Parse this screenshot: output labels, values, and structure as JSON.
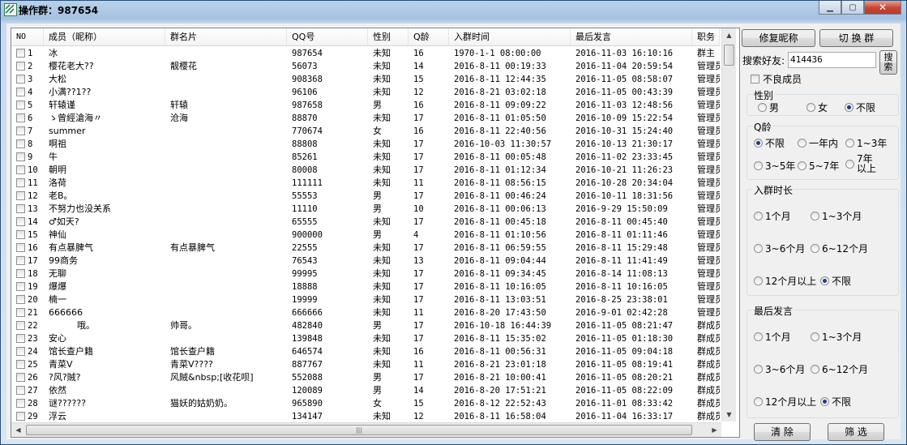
{
  "window": {
    "title": "操作群：987654"
  },
  "list": {
    "headers": [
      "NO",
      "成员（昵称）",
      "群名片",
      "QQ号",
      "性别",
      "Q龄",
      "入群时间",
      "最后发言",
      "职务"
    ],
    "rows": [
      [
        "1",
        "冰",
        "",
        "987654",
        "未知",
        "16",
        "1970-1-1 08:00:00",
        "2016-11-03 16:10:16",
        "群主"
      ],
      [
        "2",
        "樱花老大??",
        "靓樱花",
        "56073",
        "未知",
        "14",
        "2016-8-11 00:19:33",
        "2016-11-04 20:59:54",
        "管理员"
      ],
      [
        "3",
        "大松",
        "",
        "908368",
        "未知",
        "15",
        "2016-8-11 12:44:35",
        "2016-11-05 08:58:07",
        "管理员"
      ],
      [
        "4",
        "小满??1??",
        "",
        "96106",
        "未知",
        "12",
        "2016-8-21 03:02:18",
        "2016-11-05 00:43:39",
        "管理员"
      ],
      [
        "5",
        "轩辕谨",
        "轩辕",
        "987658",
        "男",
        "16",
        "2016-8-11 09:09:22",
        "2016-11-03 12:48:56",
        "管理员"
      ],
      [
        "6",
        "ゝ曾經滄海〃",
        "沧海",
        "88870",
        "未知",
        "17",
        "2016-8-11 01:05:50",
        "2016-10-09 15:22:54",
        "管理员"
      ],
      [
        "7",
        "summer",
        "",
        "770674",
        "女",
        "16",
        "2016-8-11 22:40:56",
        "2016-10-31 15:24:40",
        "管理员"
      ],
      [
        "8",
        "啊祖",
        "",
        "88808",
        "未知",
        "17",
        "2016-10-03 11:30:57",
        "2016-10-13 21:30:17",
        "管理员"
      ],
      [
        "9",
        "牛",
        "",
        "85261",
        "未知",
        "17",
        "2016-8-11 00:05:48",
        "2016-11-02 23:33:45",
        "管理员"
      ],
      [
        "10",
        "朝明",
        "",
        "80008",
        "未知",
        "17",
        "2016-8-11 01:12:34",
        "2016-10-21 11:26:23",
        "管理员"
      ],
      [
        "11",
        "洛荷",
        "",
        "111111",
        "未知",
        "11",
        "2016-8-11 08:56:15",
        "2016-10-28 20:34:04",
        "管理员"
      ],
      [
        "12",
        "老B。",
        "",
        "55553",
        "男",
        "17",
        "2016-8-11 00:46:24",
        "2016-10-11 18:31:56",
        "管理员"
      ],
      [
        "13",
        "不努力也没关系",
        "",
        "11110",
        "男",
        "10",
        "2016-8-11 00:06:13",
        "2016-9-29 15:50:09",
        "管理员"
      ],
      [
        "14",
        "♂如天?",
        "",
        "65555",
        "未知",
        "17",
        "2016-8-11 00:45:18",
        "2016-8-11 00:45:40",
        "管理员"
      ],
      [
        "15",
        "神仙",
        "",
        "900000",
        "男",
        "4",
        "2016-8-11 01:10:56",
        "2016-8-11 01:11:46",
        "管理员"
      ],
      [
        "16",
        "有点暴脾气",
        "有点暴脾气",
        "22555",
        "未知",
        "17",
        "2016-8-11 06:59:55",
        "2016-8-11 15:29:48",
        "管理员"
      ],
      [
        "17",
        "99商务",
        "",
        "76543",
        "未知",
        "13",
        "2016-8-11 09:04:44",
        "2016-8-11 11:41:49",
        "管理员"
      ],
      [
        "18",
        "无聊",
        "",
        "99995",
        "未知",
        "17",
        "2016-8-11 09:34:45",
        "2016-8-14 11:08:13",
        "管理员"
      ],
      [
        "19",
        "爆爆",
        "",
        "18888",
        "未知",
        "17",
        "2016-8-11 10:16:05",
        "2016-8-11 10:16:05",
        "管理员"
      ],
      [
        "20",
        "楠一",
        "",
        "19999",
        "未知",
        "17",
        "2016-8-11 13:03:51",
        "2016-8-25 23:38:01",
        "管理员"
      ],
      [
        "21",
        "666666",
        "",
        "666666",
        "未知",
        "11",
        "2016-8-20 17:43:50",
        "2016-9-01 02:42:28",
        "管理员"
      ],
      [
        "22",
        "          哦。",
        "帅哥。",
        "482840",
        "男",
        "17",
        "2016-10-18 16:44:39",
        "2016-11-05 08:21:47",
        "群成员"
      ],
      [
        "23",
        "安心",
        "",
        "139848",
        "未知",
        "17",
        "2016-8-11 15:35:02",
        "2016-11-05 01:18:30",
        "群成员"
      ],
      [
        "24",
        "馆长查户籍",
        "馆长查户籍",
        "646574",
        "未知",
        "16",
        "2016-8-11 00:56:31",
        "2016-11-05 09:04:18",
        "群成员"
      ],
      [
        "25",
        "青菜V",
        "青菜V????",
        "887767",
        "未知",
        "11",
        "2016-8-21 23:01:18",
        "2016-11-05 08:19:41",
        "群成员"
      ],
      [
        "26",
        "?风?賊?",
        "风賊&nbsp;[收花呗]",
        "552088",
        "男",
        "17",
        "2016-8-21 10:00:41",
        "2016-11-05 08:20:21",
        "群成员"
      ],
      [
        "27",
        "依然",
        "",
        "120089",
        "男",
        "14",
        "2016-8-20 17:51:21",
        "2016-11-05 08:22:09",
        "群成员"
      ],
      [
        "28",
        "谜??????",
        "猫妖的姑奶奶。",
        "965890",
        "女",
        "15",
        "2016-8-12 22:52:43",
        "2016-11-01 08:33:42",
        "群成员"
      ],
      [
        "29",
        "浮云",
        "",
        "134147",
        "未知",
        "12",
        "2016-8-11 16:58:04",
        "2016-11-04 16:33:17",
        "群成员"
      ]
    ]
  },
  "panel": {
    "fix_nick": "修复昵称",
    "switch_group": "切 换 群",
    "search_label": "搜索好友:",
    "search_value": "414436",
    "search_btn": "搜索",
    "bad_member": "不良成员",
    "gender": {
      "title": "性别",
      "options": [
        "男",
        "女",
        "不限"
      ]
    },
    "qage": {
      "title": "Q龄",
      "options": [
        "不限",
        "一年内",
        "1~3年",
        "3~5年",
        "5~7年",
        "7年以上"
      ]
    },
    "join": {
      "title": "入群时长",
      "options": [
        "1个月",
        "1~3个月",
        "3~6个月",
        "6~12个月",
        "12个月以上",
        "不限"
      ]
    },
    "last": {
      "title": "最后发言",
      "options": [
        "1个月",
        "1~3个月",
        "3~6个月",
        "6~12个月",
        "12个月以上",
        "不限"
      ]
    },
    "clear": "清  除",
    "filter": "筛  选"
  }
}
